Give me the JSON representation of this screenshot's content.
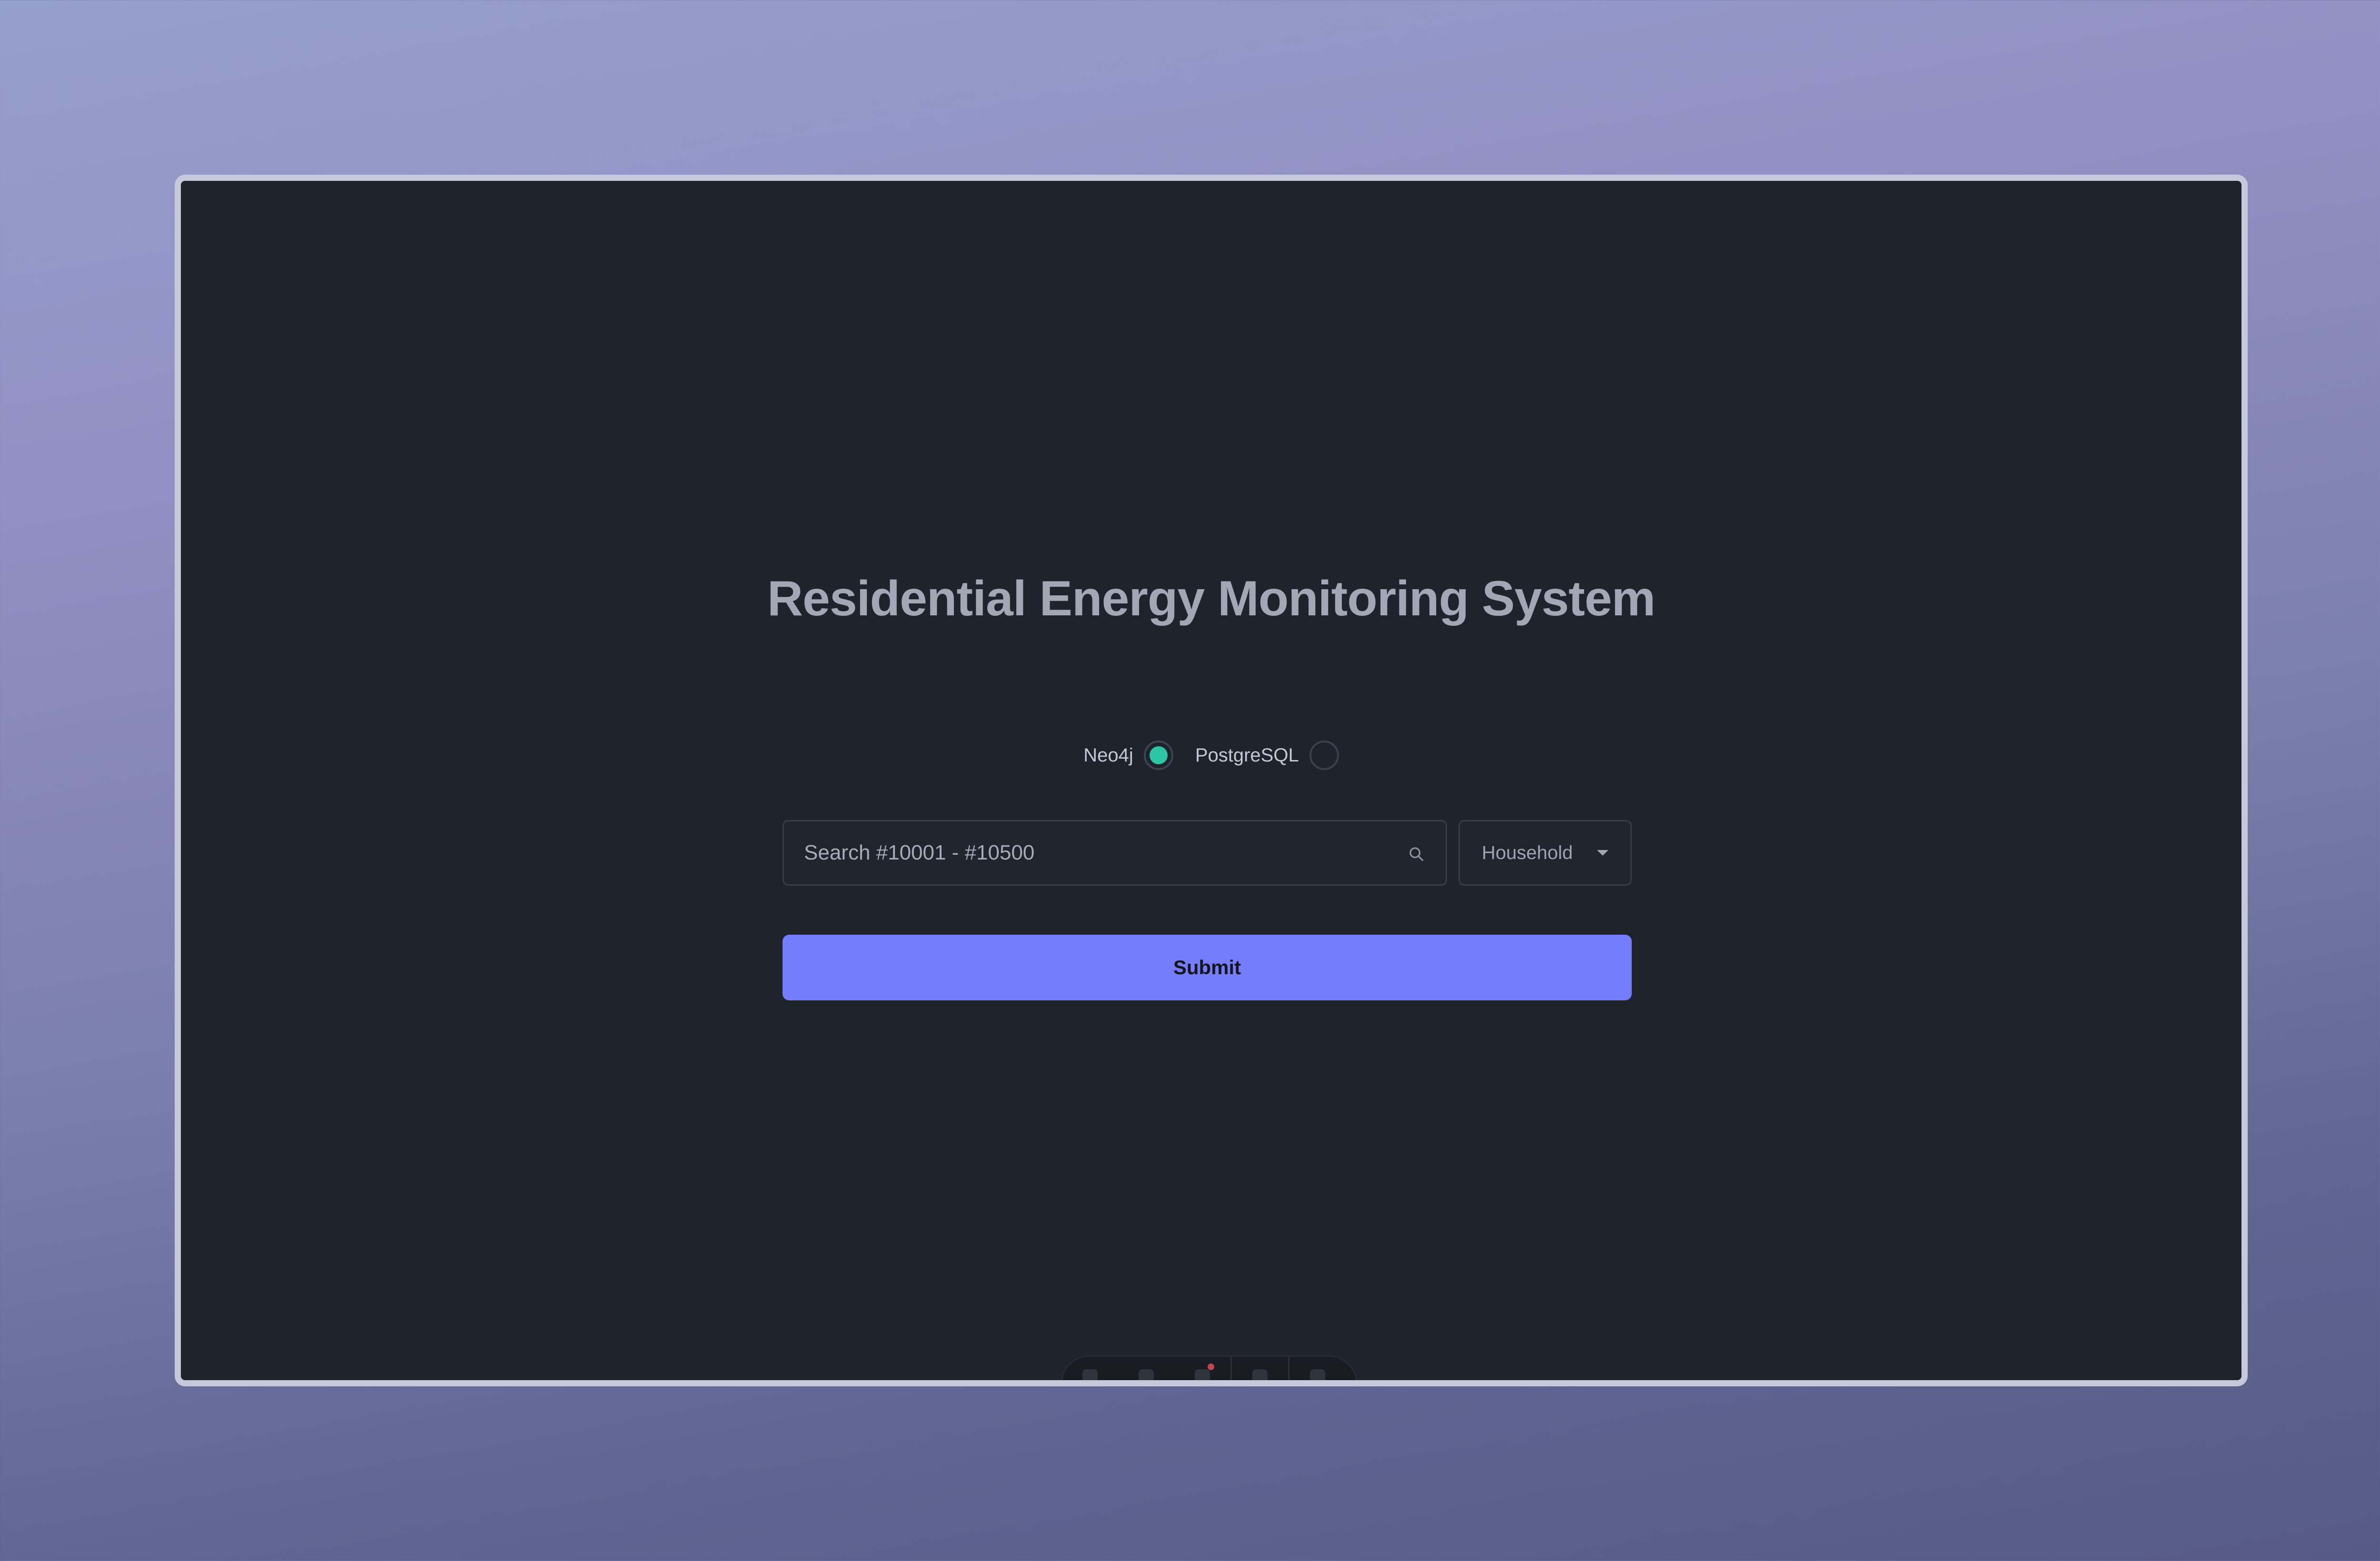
{
  "app": {
    "title": "Residential Energy Monitoring System"
  },
  "database_switch": {
    "options": [
      {
        "label": "Neo4j",
        "selected": true
      },
      {
        "label": "PostgreSQL",
        "selected": false
      }
    ]
  },
  "search": {
    "placeholder": "Search #10001 - #10500",
    "value": ""
  },
  "entity_select": {
    "selected": "Household"
  },
  "submit": {
    "label": "Submit"
  },
  "dock": {
    "items": [
      "user-icon",
      "ruler-icon",
      "list-icon",
      "pointer-icon",
      "settings-icon"
    ]
  },
  "colors": {
    "background_gradient_top": "#959fcd",
    "background_gradient_bottom": "#575a86",
    "panel": "#1f232b",
    "title": "#a2a7b6",
    "accent_radio": "#2ec4a6",
    "submit_button": "#757dfc"
  }
}
